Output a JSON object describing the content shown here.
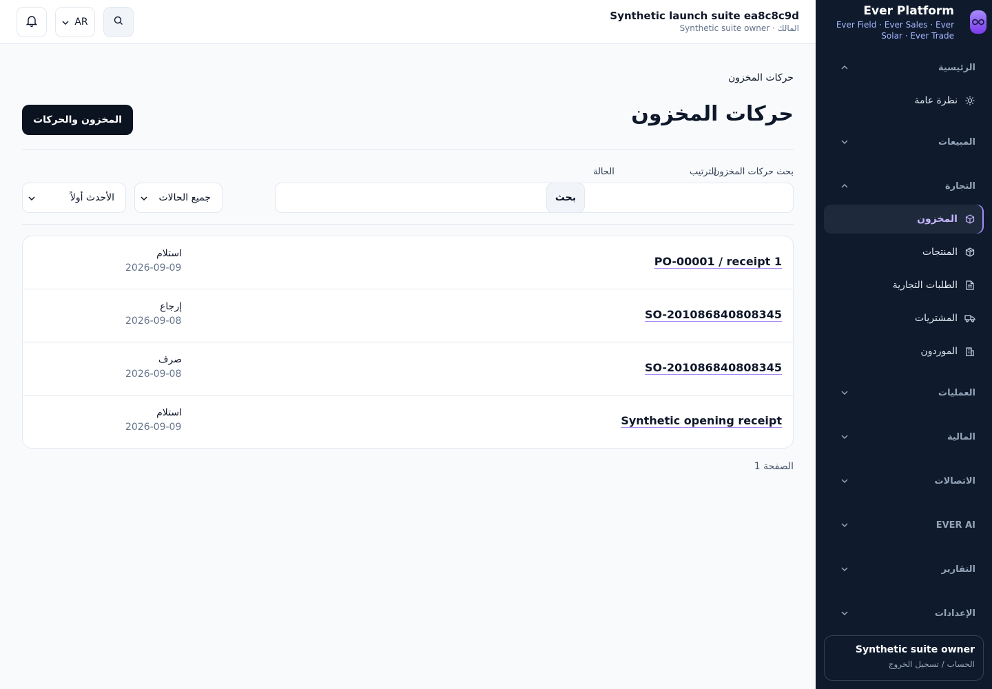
{
  "brand": {
    "title": "Ever Platform",
    "subtitle": "Ever Field · Ever Sales · Ever Solar · Ever Trade"
  },
  "sidebar": {
    "sections": [
      {
        "label": "الرئيسية",
        "expanded": true
      },
      {
        "label": "المبيعات",
        "expanded": false
      },
      {
        "label": "التجارة",
        "expanded": true
      },
      {
        "label": "العمليات",
        "expanded": false
      },
      {
        "label": "المالية",
        "expanded": false
      },
      {
        "label": "الاتصالات",
        "expanded": false
      },
      {
        "label": "EVER AI",
        "expanded": false
      },
      {
        "label": "التقارير",
        "expanded": false
      },
      {
        "label": "الإعدادات",
        "expanded": false
      }
    ],
    "items": [
      {
        "label": "نظرة عامة",
        "icon": "sun-icon"
      },
      {
        "label": "المخزون",
        "icon": "box-icon",
        "active": true
      },
      {
        "label": "المنتجات",
        "icon": "package-icon"
      },
      {
        "label": "الطلبات التجارية",
        "icon": "document-icon"
      },
      {
        "label": "المشتريات",
        "icon": "truck-icon"
      },
      {
        "label": "الموردون",
        "icon": "building-icon"
      }
    ],
    "user": {
      "name": "Synthetic suite owner",
      "sub": "الحساب / تسجيل الخروج"
    }
  },
  "topbar": {
    "title": "Synthetic launch suite ea8c8c9d",
    "subtitle": "المالك · Synthetic suite owner",
    "language": "AR"
  },
  "main": {
    "breadcrumb": "حركات المخزون",
    "title": "حركات المخزون",
    "primary_button": "المخزون والحركات",
    "filters": {
      "search_label": "بحث حركات المخزون",
      "search_value": "",
      "search_button": "بحث",
      "status_label": "الحالة",
      "status_value": "جميع الحالات",
      "sort_label": "الترتيب",
      "sort_value": "الأحدث أولاً"
    },
    "rows": [
      {
        "ref": "PO-00001 / receipt 1",
        "type": "استلام",
        "date": "2026-09-09"
      },
      {
        "ref": "SO-201086840808345",
        "type": "إرجاع",
        "date": "2026-09-08"
      },
      {
        "ref": "SO-201086840808345",
        "type": "صرف",
        "date": "2026-09-08"
      },
      {
        "ref": "Synthetic opening receipt",
        "type": "استلام",
        "date": "2026-09-09"
      }
    ],
    "pager": "الصفحة 1"
  },
  "colors": {
    "sidebar_bg": "#0f1b2d",
    "accent": "#a78bfa",
    "primary_button": "#0b1220"
  }
}
